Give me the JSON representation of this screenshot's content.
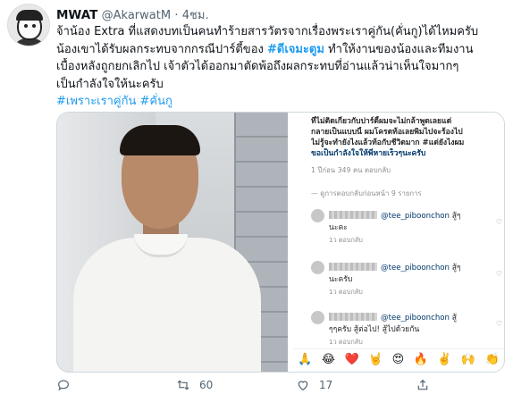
{
  "author": {
    "name": "MWAT",
    "handle": "@AkarwatM",
    "separator": "·",
    "time": "4ชม."
  },
  "tweet": {
    "line1": "จ้าน้อง Extra ที่แสดงบทเป็นคนทำร้ายสารวัตรจากเรื่องพระเราคู่กัน(คั่นกู)ได้ไหมครับ",
    "line2_pre": "น้องเขาได้รับผลกระทบจากกรณีปาร์ตี้ของ ",
    "line2_tag": "#ดีเจมะตูม",
    "line2_post": " ทำให้งานของน้องและทีมงาน",
    "line3": "เบื้องหลังถูกยกเลิกไป เจ้าตัวได้ออกมาตัดพ้อถึงผลกระทบที่อ่านแล้วน่าเห็นใจมากๆ",
    "line4": "เป็นกำลังใจให้นะครับ",
    "hashtags": "#เพราะเราคู่กัน #คั่นกู"
  },
  "instagram": {
    "caption": [
      "ที่ไม่ติดเกี่ยวกับปาร์ตี้ผมจะไม่กล้าพูดเลยแต่",
      "กลายเป็นแบบนี้ ผมโครตท้อเลยพิมไปจะร้องไป",
      "ไม่รู้จะทำยังไงแล้วท้อกับชีวิตมาก #แต่ยังไงผม",
      "ขอเป็นกำลังใจให้พี่หายเร็วๆนะครับ"
    ],
    "caption_meta": "1 ปีก่อน  349 คน  ตอบกลับ",
    "view_replies": "— ดูการตอบกลับก่อนหน้า 9 รายการ",
    "replies": [
      {
        "mention": "@tee_piboonchon",
        "suffix": " สู้ๆ",
        "text": "นะคะ",
        "meta": "1ว   ตอบกลับ"
      },
      {
        "mention": "@tee_piboonchon",
        "suffix": " สู้ๆ",
        "text": "นะครับ",
        "meta": "1ว   ตอบกลับ"
      },
      {
        "mention": "@tee_piboonchon",
        "suffix": " สู้",
        "text": "ๆๆครับ สู้ต่อไป! สู้ไปด้วยกัน",
        "meta": "1ว   ตอบกลับ"
      }
    ],
    "reactions": [
      "🙏",
      "😂",
      "❤️",
      "🤘",
      "😍",
      "🔥",
      "✌️",
      "🙌",
      "👏"
    ]
  },
  "actions": {
    "replies": "",
    "retweets": "60",
    "likes": "17"
  },
  "colors": {
    "link": "#1d9bf0",
    "muted": "#536471",
    "ig_link": "#00376b"
  }
}
